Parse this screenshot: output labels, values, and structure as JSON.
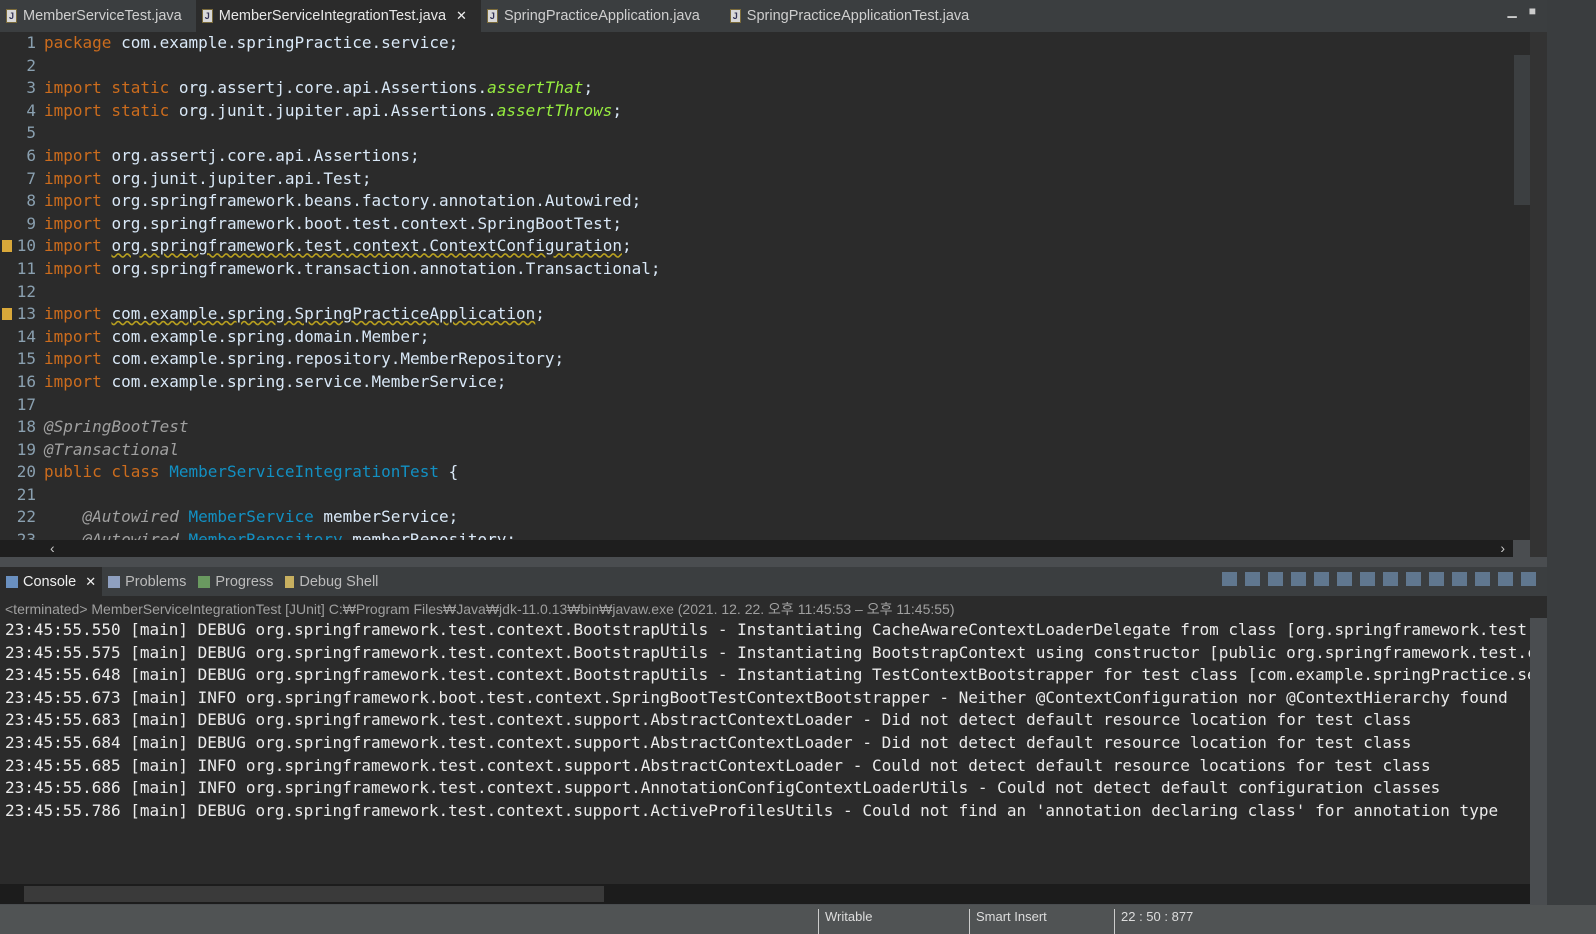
{
  "editor_tabs": [
    {
      "label": "MemberServiceTest.java",
      "active": false
    },
    {
      "label": "MemberServiceIntegrationTest.java",
      "active": true,
      "close": "✕"
    },
    {
      "label": "SpringPracticeApplication.java",
      "active": false
    },
    {
      "label": "SpringPracticeApplicationTest.java",
      "active": false
    }
  ],
  "code_lines": [
    [
      [
        "kw",
        "package "
      ],
      [
        "t",
        "com.example.springPractice.service;"
      ]
    ],
    [],
    [
      [
        "kw",
        "import static "
      ],
      [
        "t",
        "org.assertj.core.api.Assertions."
      ],
      [
        "st",
        "assertThat"
      ],
      [
        "t",
        ";"
      ]
    ],
    [
      [
        "kw",
        "import static "
      ],
      [
        "t",
        "org.junit.jupiter.api.Assertions."
      ],
      [
        "st",
        "assertThrows"
      ],
      [
        "t",
        ";"
      ]
    ],
    [],
    [
      [
        "kw",
        "import "
      ],
      [
        "t",
        "org.assertj.core.api.Assertions;"
      ]
    ],
    [
      [
        "kw",
        "import "
      ],
      [
        "t",
        "org.junit.jupiter.api.Test;"
      ]
    ],
    [
      [
        "kw",
        "import "
      ],
      [
        "t",
        "org.springframework.beans.factory.annotation.Autowired;"
      ]
    ],
    [
      [
        "kw",
        "import "
      ],
      [
        "t",
        "org.springframework.boot.test.context.SpringBootTest;"
      ]
    ],
    [
      [
        "kw",
        "import "
      ],
      [
        "warn",
        "org.springframework.test.context.ContextConfiguration"
      ],
      [
        "t",
        ";"
      ]
    ],
    [
      [
        "kw",
        "import "
      ],
      [
        "t",
        "org.springframework.transaction.annotation.Transactional;"
      ]
    ],
    [],
    [
      [
        "kw",
        "import "
      ],
      [
        "warn",
        "com.example.spring.SpringPracticeApplication"
      ],
      [
        "t",
        ";"
      ]
    ],
    [
      [
        "kw",
        "import "
      ],
      [
        "t",
        "com.example.spring.domain.Member;"
      ]
    ],
    [
      [
        "kw",
        "import "
      ],
      [
        "t",
        "com.example.spring.repository.MemberRepository;"
      ]
    ],
    [
      [
        "kw",
        "import "
      ],
      [
        "t",
        "com.example.spring.service.MemberService;"
      ]
    ],
    [],
    [
      [
        "ann",
        "@SpringBootTest"
      ]
    ],
    [
      [
        "ann",
        "@Transactional"
      ]
    ],
    [
      [
        "kw",
        "public class "
      ],
      [
        "cls",
        "MemberServiceIntegrationTest"
      ],
      [
        "t",
        " {"
      ]
    ],
    [],
    [
      [
        "t",
        "    "
      ],
      [
        "ann",
        "@Autowired "
      ],
      [
        "cls",
        "MemberService"
      ],
      [
        "t",
        " memberService;"
      ]
    ],
    [
      [
        "t",
        "    "
      ],
      [
        "ann",
        "@Autowired "
      ],
      [
        "cls",
        "MemberRepository"
      ],
      [
        "t",
        " memberRepository;"
      ]
    ]
  ],
  "warning_lines": [
    10,
    13
  ],
  "console_tabs": [
    {
      "label": "Console",
      "active": true,
      "close": "✕"
    },
    {
      "label": "Problems"
    },
    {
      "label": "Progress"
    },
    {
      "label": "Debug Shell"
    }
  ],
  "console_status": "<terminated> MemberServiceIntegrationTest [JUnit] C:₩Program Files₩Java₩jdk-11.0.13₩bin₩javaw.exe  (2021. 12. 22. 오후 11:45:53 – 오후 11:45:55)",
  "console_lines": [
    "23:45:55.550 [main] DEBUG org.springframework.test.context.BootstrapUtils - Instantiating CacheAwareContextLoaderDelegate from class [org.springframework.test.context.cache.DefaultCacheAwareContextLoaderDelegate]",
    "23:45:55.575 [main] DEBUG org.springframework.test.context.BootstrapUtils - Instantiating BootstrapContext using constructor [public org.springframework.test.context.support.DefaultBootstrapContext",
    "23:45:55.648 [main] DEBUG org.springframework.test.context.BootstrapUtils - Instantiating TestContextBootstrapper for test class [com.example.springPractice.service",
    "23:45:55.673 [main] INFO org.springframework.boot.test.context.SpringBootTestContextBootstrapper - Neither @ContextConfiguration nor @ContextHierarchy found",
    "23:45:55.683 [main] DEBUG org.springframework.test.context.support.AbstractContextLoader - Did not detect default resource location for test class",
    "23:45:55.684 [main] DEBUG org.springframework.test.context.support.AbstractContextLoader - Did not detect default resource location for test class",
    "23:45:55.685 [main] INFO org.springframework.test.context.support.AbstractContextLoader - Could not detect default resource locations for test class",
    "23:45:55.686 [main] INFO org.springframework.test.context.support.AnnotationConfigContextLoaderUtils - Could not detect default configuration classes",
    "23:45:55.786 [main] DEBUG org.springframework.test.context.support.ActiveProfilesUtils - Could not find an 'annotation declaring class' for annotation type"
  ],
  "statusbar": {
    "writable": "Writable",
    "insert_mode": "Smart Insert",
    "position": "22 : 50 : 877"
  }
}
